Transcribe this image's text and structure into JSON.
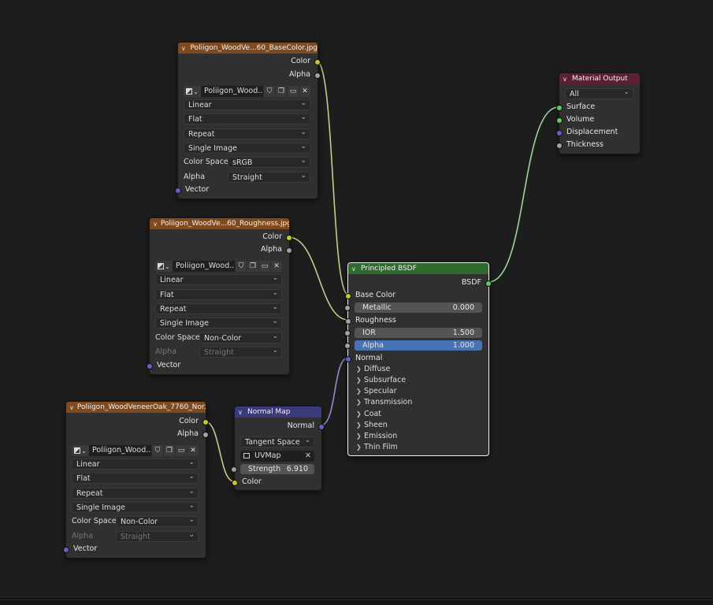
{
  "nodes": {
    "base_color": {
      "title": "Poliigon_WoodVe...60_BaseColor.jpg",
      "out_color": "Color",
      "out_alpha": "Alpha",
      "image_name": "Poliigon_Wood...",
      "interpolation": "Linear",
      "projection": "Flat",
      "extension": "Repeat",
      "source": "Single Image",
      "color_space_label": "Color Space",
      "color_space": "sRGB",
      "alpha_label": "Alpha",
      "alpha_mode": "Straight",
      "in_vector": "Vector"
    },
    "roughness": {
      "title": "Poliigon_WoodVe...60_Roughness.jpg",
      "out_color": "Color",
      "out_alpha": "Alpha",
      "image_name": "Poliigon_Wood...",
      "interpolation": "Linear",
      "projection": "Flat",
      "extension": "Repeat",
      "source": "Single Image",
      "color_space_label": "Color Space",
      "color_space": "Non-Color",
      "alpha_label": "Alpha",
      "alpha_mode": "Straight",
      "in_vector": "Vector"
    },
    "normal_tex": {
      "title": "Poliigon_WoodVeneerOak_7760_Nor...",
      "out_color": "Color",
      "out_alpha": "Alpha",
      "image_name": "Poliigon_Wood...",
      "interpolation": "Linear",
      "projection": "Flat",
      "extension": "Repeat",
      "source": "Single Image",
      "color_space_label": "Color Space",
      "color_space": "Non-Color",
      "alpha_label": "Alpha",
      "alpha_mode": "Straight",
      "in_vector": "Vector"
    },
    "normal_map": {
      "title": "Normal Map",
      "out_normal": "Normal",
      "space": "Tangent Space",
      "uv_map": "UVMap",
      "strength_label": "Strength",
      "strength_value": "6.910",
      "in_color": "Color"
    },
    "bsdf": {
      "title": "Principled BSDF",
      "out_bsdf": "BSDF",
      "base_color": "Base Color",
      "metallic_label": "Metallic",
      "metallic_value": "0.000",
      "roughness": "Roughness",
      "ior_label": "IOR",
      "ior_value": "1.500",
      "alpha_label": "Alpha",
      "alpha_value": "1.000",
      "normal": "Normal",
      "panels": [
        "Diffuse",
        "Subsurface",
        "Specular",
        "Transmission",
        "Coat",
        "Sheen",
        "Emission",
        "Thin Film"
      ]
    },
    "output": {
      "title": "Material Output",
      "target": "All",
      "surface": "Surface",
      "volume": "Volume",
      "displacement": "Displacement",
      "thickness": "Thickness"
    }
  },
  "colors": {
    "link_color": "#c9c98a",
    "link_vector": "#8d8dcf",
    "link_shader": "#9fd39f"
  }
}
